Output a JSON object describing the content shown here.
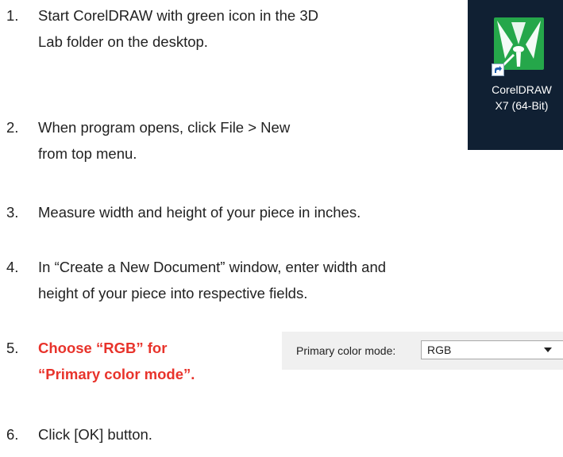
{
  "steps": [
    {
      "number": "1.",
      "lines": [
        "Start CorelDRAW with green icon in the 3D",
        "Lab folder on the desktop."
      ]
    },
    {
      "number": "2.",
      "lines": [
        "When program opens, click File > New",
        "from top menu."
      ]
    },
    {
      "number": "3.",
      "lines": [
        "Measure width and height of your piece in inches."
      ]
    },
    {
      "number": "4.",
      "lines": [
        "In “Create a New Document” window, enter width and",
        "height of your piece into respective fields."
      ]
    },
    {
      "number": "5.",
      "lines": [
        "Choose “RGB” for",
        "“Primary color mode”."
      ]
    },
    {
      "number": "6.",
      "lines": [
        "Click [OK] button."
      ]
    }
  ],
  "desktop_icon": {
    "label_line1": "CorelDRAW",
    "label_line2": "X7 (64-Bit)",
    "icon": "coreldraw-app-icon",
    "shortcut_icon": "shortcut-arrow-icon",
    "tile_color": "#25a74a",
    "background_color": "#102033"
  },
  "color_mode_widget": {
    "label": "Primary color mode:",
    "selected_value": "RGB",
    "dropdown_icon": "chevron-down-icon"
  },
  "colors": {
    "emphasis": "#e8332b",
    "text": "#222222"
  }
}
